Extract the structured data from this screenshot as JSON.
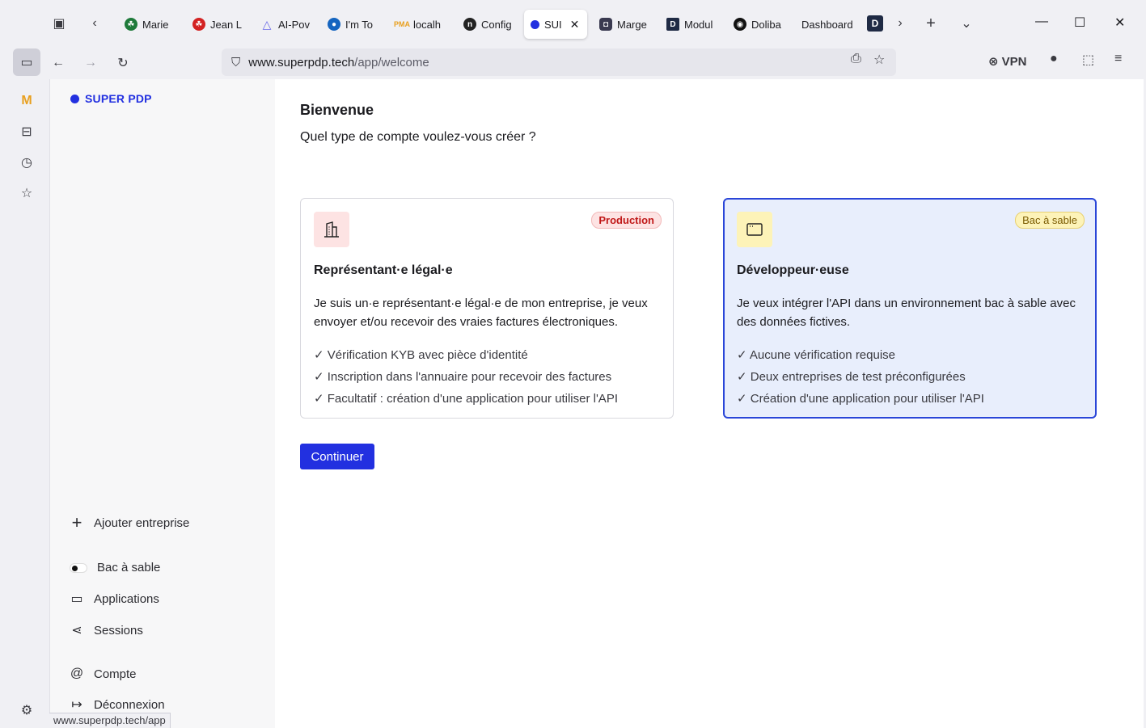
{
  "browser": {
    "tabs": [
      {
        "label": "Marie",
        "fav_color": "#1e7a3a"
      },
      {
        "label": "Jean L",
        "fav_color": "#d32222"
      },
      {
        "label": "AI-Pov",
        "fav_color": "#6a6ae8"
      },
      {
        "label": "I'm To",
        "fav_color": "#1565c0"
      },
      {
        "label": "localh",
        "fav_color": "#e8a020"
      },
      {
        "label": "Config",
        "fav_color": "#222222"
      },
      {
        "label": "SUI",
        "fav_color": "#2230e0",
        "active": true
      },
      {
        "label": "Marge",
        "fav_color": "#3a3a50"
      },
      {
        "label": "Modul",
        "fav_color": "#1f2a44"
      },
      {
        "label": "Doliba",
        "fav_color": "#111111"
      },
      {
        "label": "Dashboard",
        "fav_color": ""
      }
    ],
    "url_host": "www.superpdp.tech",
    "url_path": "/app/welcome",
    "vpn_label": "VPN",
    "status_url": "www.superpdp.tech/app"
  },
  "app": {
    "brand": "SUPER PDP",
    "brand_color": "#2230e0",
    "nav": {
      "add_company": "Ajouter entreprise",
      "sandbox": "Bac à sable",
      "applications": "Applications",
      "sessions": "Sessions",
      "account": "Compte",
      "logout": "Déconnexion"
    }
  },
  "welcome": {
    "title": "Bienvenue",
    "subtitle": "Quel type de compte voulez-vous créer ?",
    "continue": "Continuer",
    "cards": [
      {
        "badge": "Production",
        "title": "Représentant·e légal·e",
        "description": "Je suis un·e représentant·e légal·e de mon entreprise, je veux envoyer et/ou recevoir des vraies factures électroniques.",
        "features": [
          "✓ Vérification KYB avec pièce d'identité",
          "✓ Inscription dans l'annuaire pour recevoir des factures",
          "✓ Facultatif : création d'une application pour utiliser l'API"
        ],
        "selected": false
      },
      {
        "badge": "Bac à sable",
        "title": "Développeur·euse",
        "description": "Je veux intégrer l'API dans un environnement bac à sable avec des données fictives.",
        "features": [
          "✓ Aucune vérification requise",
          "✓ Deux entreprises de test préconfigurées",
          "✓ Création d'une application pour utiliser l'API"
        ],
        "selected": true
      }
    ]
  }
}
